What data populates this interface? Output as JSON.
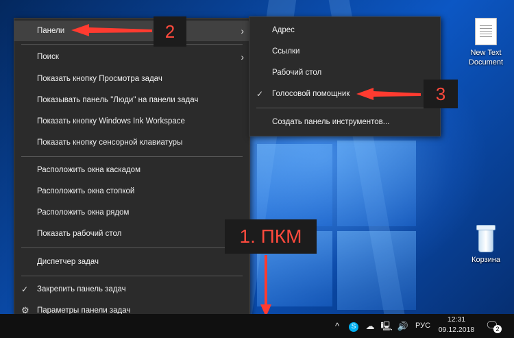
{
  "desktop": {
    "icons": [
      {
        "label": "New Text Document",
        "icon": "text-document-icon"
      },
      {
        "label": "Корзина",
        "icon": "recycle-bin-icon"
      }
    ]
  },
  "main_menu": {
    "items": [
      {
        "label": "Панели"
      },
      {
        "label": "Поиск"
      },
      {
        "label": "Показать кнопку Просмотра задач"
      },
      {
        "label": "Показывать панель \"Люди\" на панели задач"
      },
      {
        "label": "Показать кнопку Windows Ink Workspace"
      },
      {
        "label": "Показать кнопку сенсорной клавиатуры"
      },
      {
        "label": "Расположить окна каскадом"
      },
      {
        "label": "Расположить окна стопкой"
      },
      {
        "label": "Расположить окна рядом"
      },
      {
        "label": "Показать рабочий стол"
      },
      {
        "label": "Диспетчер задач"
      },
      {
        "label": "Закрепить панель задач"
      },
      {
        "label": "Параметры панели задач"
      }
    ]
  },
  "sub_menu": {
    "items": [
      {
        "label": "Адрес"
      },
      {
        "label": "Ссылки"
      },
      {
        "label": "Рабочий стол"
      },
      {
        "label": "Голосовой помощник"
      },
      {
        "label": "Создать панель инструментов..."
      }
    ]
  },
  "annotations": {
    "step1": "1. ПКМ",
    "step2": "2",
    "step3": "3",
    "color": "#ff3b30"
  },
  "taskbar": {
    "language": "РУС",
    "time": "12:31",
    "date": "09.12.2018",
    "notification_count": "2"
  }
}
